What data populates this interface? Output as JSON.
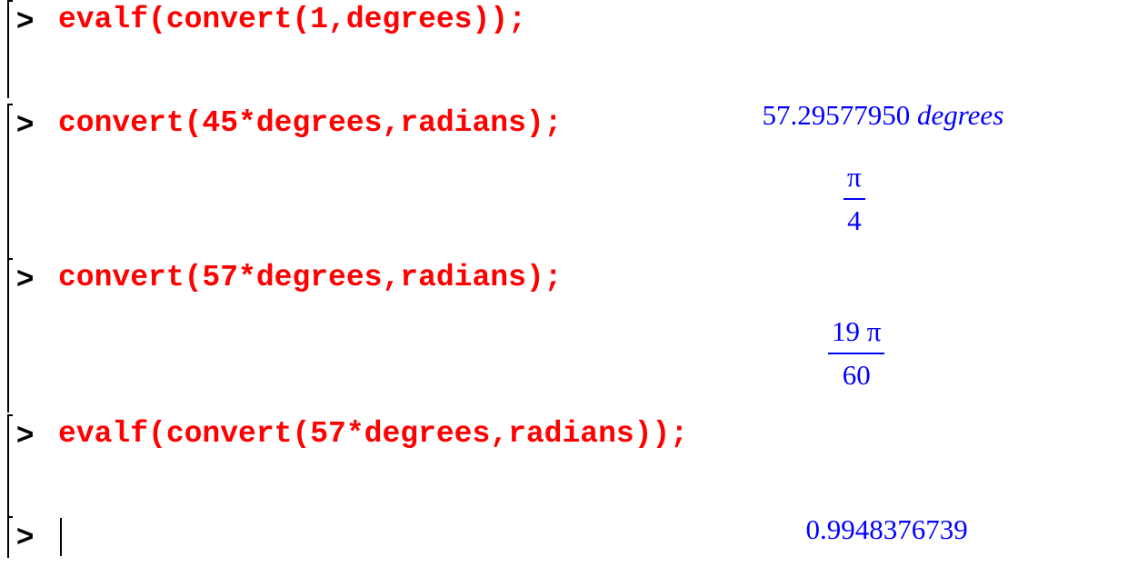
{
  "prompt_symbol": ">",
  "groups": [
    {
      "input": "evalf(convert(1,degrees));",
      "output_value": "57.29577950",
      "output_unit": "degrees"
    },
    {
      "input": "convert(45*degrees,radians);",
      "output_numerator": "π",
      "output_denominator": "4"
    },
    {
      "input": "convert(57*degrees,radians);",
      "output_numerator": "19 π",
      "output_denominator": "60"
    },
    {
      "input": "evalf(convert(57*degrees,radians));",
      "output_value": "0.9948376739"
    },
    {
      "input": ""
    }
  ],
  "colors": {
    "input": "#ff0000",
    "output": "#0000ff",
    "prompt": "#000000",
    "background": "#ffffff"
  }
}
